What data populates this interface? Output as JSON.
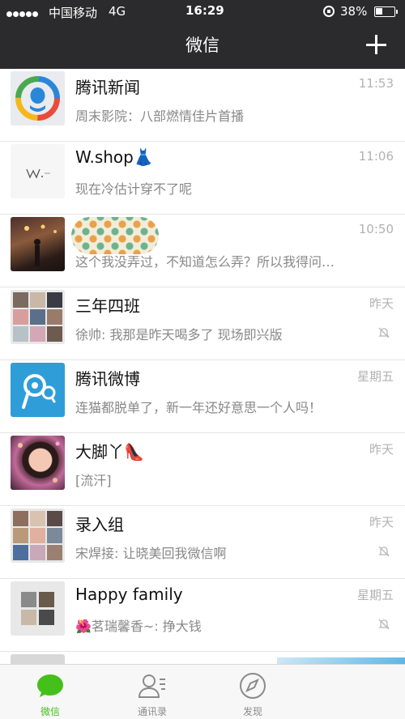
{
  "status_bar": {
    "carrier": "中国移动",
    "network": "4G",
    "time": "16:29",
    "battery": "38%",
    "battery_level": 0.38
  },
  "nav": {
    "title": "微信",
    "add_icon": "plus-icon"
  },
  "chats": [
    {
      "name": "腾讯新闻",
      "preview": "周末影院：八部燃情佳片首播",
      "time": "11:53",
      "muted": false,
      "avatar": "tencent-news-logo"
    },
    {
      "name": "W.shop👗",
      "preview": "现在冷估计穿不了呢",
      "time": "11:06",
      "muted": false,
      "avatar": "wshop-logo"
    },
    {
      "name": "",
      "preview": "这个我没弄过，不知道怎么弄？所以我得问…",
      "time": "10:50",
      "muted": false,
      "avatar": "photo-street"
    },
    {
      "name": "三年四班",
      "preview": "徐帅: 我那是昨天喝多了 现场即兴版",
      "time": "昨天",
      "muted": true,
      "avatar": "group-grid"
    },
    {
      "name": "腾讯微博",
      "preview": "连猫都脱单了，新一年还好意思一个人吗！",
      "time": "星期五",
      "muted": false,
      "avatar": "tencent-weibo-logo"
    },
    {
      "name": "大脚丫👠",
      "preview": "[流汗]",
      "time": "昨天",
      "muted": false,
      "avatar": "photo-portrait"
    },
    {
      "name": "录入组",
      "preview": "宋焊接: 让晓美回我微信啊",
      "time": "昨天",
      "muted": true,
      "avatar": "group-grid"
    },
    {
      "name": "Happy family",
      "preview": "🌺茗瑞馨香~: 挣大钱",
      "time": "星期五",
      "muted": true,
      "avatar": "group-grid"
    }
  ],
  "tabs": [
    {
      "label": "微信",
      "icon": "chat-bubble-icon",
      "active": true
    },
    {
      "label": "通讯录",
      "icon": "contacts-icon",
      "active": false
    },
    {
      "label": "发现",
      "icon": "compass-icon",
      "active": false
    }
  ],
  "colors": {
    "accent": "#45c01a",
    "topbar": "#2b2b2d",
    "muted_text": "#888888"
  }
}
